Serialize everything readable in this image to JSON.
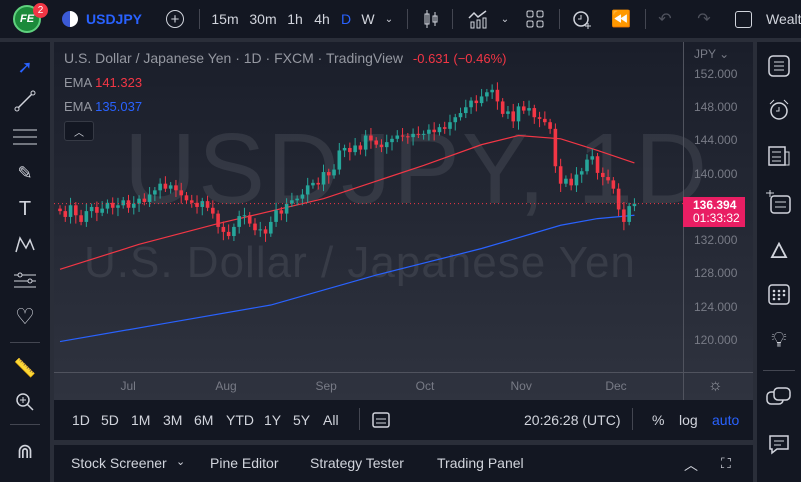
{
  "topbar": {
    "notification_count": "2",
    "symbol": "USDJPY",
    "intervals": [
      "15m",
      "30m",
      "1h",
      "4h",
      "D",
      "W"
    ],
    "active_interval": "D",
    "watchlist_label": "Wealt"
  },
  "legend": {
    "title": "U.S. Dollar / Japanese Yen · 1D · FXCM · TradingView",
    "change": "-0.631 (−0.46%)",
    "ema1_label": "EMA",
    "ema1_value": "141.323",
    "ema2_label": "EMA",
    "ema2_value": "135.037"
  },
  "watermark": {
    "symbol": "USDJPY, 1D",
    "name": "U.S. Dollar / Japanese Yen"
  },
  "price_axis": {
    "currency": "JPY",
    "ticks": [
      "152.000",
      "148.000",
      "144.000",
      "140.000",
      "132.000",
      "128.000",
      "124.000",
      "120.000"
    ],
    "last_price": "136.394",
    "countdown": "01:33:32"
  },
  "time_axis": {
    "labels": [
      "Jul",
      "Aug",
      "Sep",
      "Oct",
      "Nov",
      "Dec"
    ]
  },
  "range_bar": {
    "ranges": [
      "1D",
      "5D",
      "1M",
      "3M",
      "6M",
      "YTD",
      "1Y",
      "5Y",
      "All"
    ],
    "clock": "20:26:28 (UTC)",
    "percent": "%",
    "log": "log",
    "auto": "auto"
  },
  "bottom_panel": {
    "tabs": [
      "Stock Screener",
      "Pine Editor",
      "Strategy Tester",
      "Trading Panel"
    ]
  },
  "colors": {
    "up": "#26a69a",
    "down": "#f23645",
    "ema_fast": "#f23645",
    "ema_slow": "#2962ff",
    "accent": "#2962ff",
    "price_label": "#e91e63"
  },
  "chart_data": {
    "type": "candlestick",
    "symbol": "USDJPY",
    "ylim": [
      118,
      154
    ],
    "closes": [
      135.5,
      134.8,
      136.2,
      135.0,
      134.2,
      135.5,
      136.0,
      135.3,
      135.8,
      136.5,
      135.9,
      136.2,
      136.8,
      135.9,
      136.4,
      137.0,
      136.6,
      137.5,
      138.0,
      138.8,
      138.2,
      138.6,
      138.0,
      137.4,
      136.8,
      136.5,
      136.0,
      136.7,
      135.9,
      135.2,
      133.6,
      133.0,
      132.5,
      133.6,
      134.9,
      135.0,
      134.0,
      133.2,
      133.3,
      132.8,
      134.2,
      135.6,
      135.2,
      136.4,
      136.8,
      137.0,
      137.5,
      138.6,
      138.9,
      138.7,
      140.2,
      139.8,
      140.5,
      142.8,
      143.1,
      142.6,
      143.4,
      142.9,
      144.6,
      144.0,
      143.5,
      143.2,
      143.8,
      144.2,
      144.6,
      144.5,
      144.4,
      144.8,
      144.7,
      144.8,
      145.3,
      145.0,
      145.6,
      145.4,
      146.2,
      146.8,
      147.3,
      148.0,
      148.8,
      148.5,
      149.3,
      149.8,
      150.1,
      148.7,
      147.2,
      147.5,
      146.3,
      148.1,
      147.6,
      147.9,
      146.8,
      146.6,
      146.2,
      145.4,
      140.9,
      138.8,
      139.4,
      138.6,
      139.9,
      140.3,
      141.7,
      142.1,
      140.1,
      139.6,
      139.2,
      138.2,
      135.7,
      134.2,
      136.1,
      136.4
    ],
    "ema_fast": [
      [
        0,
        128.5
      ],
      [
        15,
        131.5
      ],
      [
        30,
        134
      ],
      [
        50,
        137
      ],
      [
        69,
        141
      ],
      [
        80,
        143.5
      ],
      [
        87,
        144.6
      ],
      [
        95,
        144.2
      ],
      [
        102,
        142.8
      ],
      [
        109,
        141.3
      ]
    ],
    "ema_slow": [
      [
        0,
        119.8
      ],
      [
        20,
        122
      ],
      [
        40,
        124.2
      ],
      [
        60,
        127.8
      ],
      [
        80,
        131
      ],
      [
        95,
        133.8
      ],
      [
        102,
        134.6
      ],
      [
        109,
        135.0
      ]
    ],
    "month_index": {
      "Jul": 13,
      "Aug": 31,
      "Sep": 50,
      "Oct": 69,
      "Nov": 87,
      "Dec": 105
    }
  }
}
